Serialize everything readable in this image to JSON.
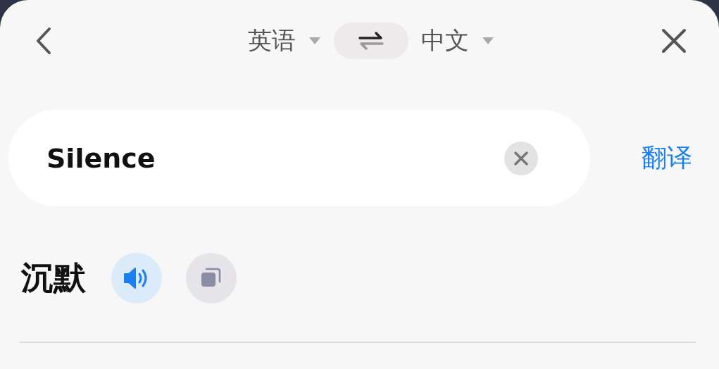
{
  "header": {
    "source_language": "英语",
    "target_language": "中文"
  },
  "input": {
    "value": "Silence"
  },
  "translate_button": "翻译",
  "result": {
    "text": "沉默"
  }
}
